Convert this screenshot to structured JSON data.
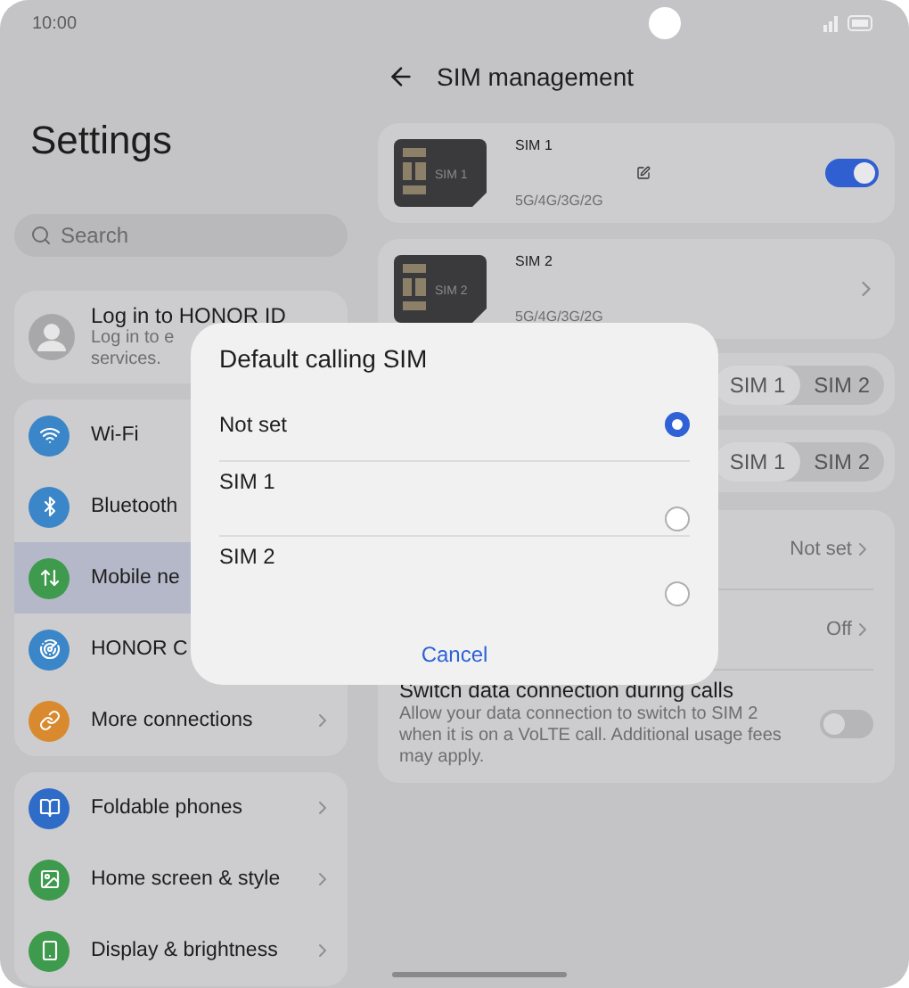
{
  "status_bar": {
    "time": "10:00"
  },
  "settings": {
    "title": "Settings",
    "search": {
      "placeholder": "Search"
    },
    "account": {
      "title": "Log in to HONOR ID",
      "subtitle": "Log in to e",
      "subtitle_2": "services."
    },
    "groups": [
      {
        "items": [
          {
            "label": "Wi-Fi",
            "color": "#3a86c8",
            "selected": false,
            "chevron": false
          },
          {
            "label": "Bluetooth",
            "color": "#3a86c8",
            "selected": false,
            "chevron": false
          },
          {
            "label": "Mobile ne",
            "color": "#3e9a4c",
            "selected": true,
            "chevron": false
          },
          {
            "label": "HONOR C",
            "color": "#3a86c8",
            "selected": false,
            "chevron": false
          },
          {
            "label": "More connections",
            "color": "#d98a2e",
            "selected": false,
            "chevron": true
          }
        ]
      },
      {
        "items": [
          {
            "label": "Foldable phones",
            "color": "#2f6cc8",
            "selected": false,
            "chevron": true
          },
          {
            "label": "Home screen & style",
            "color": "#3e9a4c",
            "selected": false,
            "chevron": true
          },
          {
            "label": "Display & brightness",
            "color": "#3e9a4c",
            "selected": false,
            "chevron": true
          }
        ]
      }
    ]
  },
  "sim_management": {
    "title": "SIM management",
    "cards": [
      {
        "kind": "toggle",
        "name": "SIM 1",
        "chip": "SIM 1",
        "networks": "5G/4G/3G/2G",
        "editable": true,
        "on": true
      },
      {
        "kind": "chevron",
        "name": "SIM 2",
        "chip": "SIM 2",
        "networks": "5G/4G/3G/2G",
        "editable": false
      }
    ],
    "segments": [
      {
        "options": [
          {
            "label": "SIM 1",
            "selected": true
          },
          {
            "label": "SIM 2",
            "selected": false
          }
        ]
      },
      {
        "options": [
          {
            "label": "SIM 1",
            "selected": true
          },
          {
            "label": "SIM 2",
            "selected": false
          }
        ]
      }
    ],
    "rows": [
      {
        "kind": "value",
        "value": "Not set"
      },
      {
        "kind": "value",
        "value": "Off"
      },
      {
        "kind": "switch",
        "title": "Switch data connection during calls",
        "description": "Allow your data connection to switch to SIM 2 when it is on a VoLTE call. Additional usage fees may apply.",
        "on": false
      }
    ]
  },
  "dialog": {
    "title": "Default calling SIM",
    "options": [
      {
        "label": "Not set",
        "selected": true
      },
      {
        "label": "SIM 1",
        "selected": false
      },
      {
        "label": "SIM 2",
        "selected": false
      }
    ],
    "cancel": "Cancel"
  }
}
